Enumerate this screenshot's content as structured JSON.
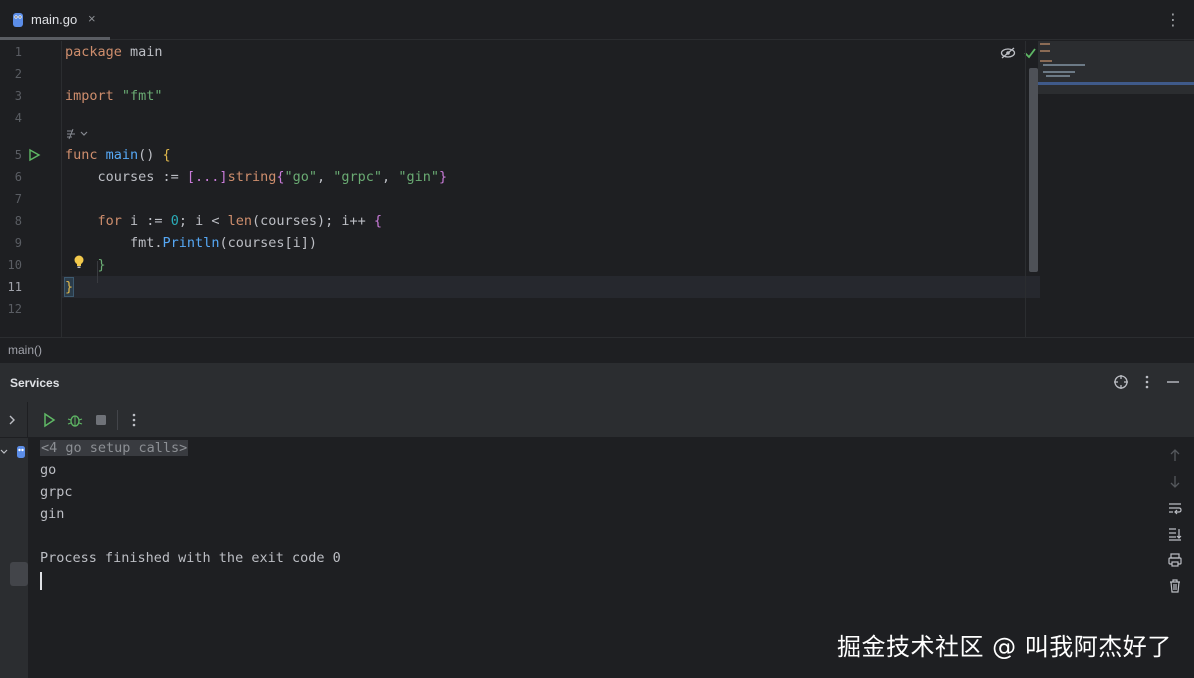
{
  "tabs": [
    {
      "label": "main.go",
      "close": "×"
    }
  ],
  "tab_menu_label": "⋮",
  "editor": {
    "line_numbers": [
      "1",
      "2",
      "3",
      "4",
      "5",
      "6",
      "7",
      "8",
      "9",
      "10",
      "11",
      "12"
    ],
    "current_line": "11",
    "lines": {
      "l1_kw": "package",
      "l1_rest": " main",
      "l3_kw": "import",
      "l3_str": " \"fmt\"",
      "l5_kw": "func",
      "l5_fn": " main",
      "l5_paren": "()",
      "l5_brace": " {",
      "l6_a": "    courses := ",
      "l6_b": "[...]",
      "l6_c": "string",
      "l6_d": "{",
      "l6_e": "\"go\"",
      "l6_f": ", ",
      "l6_g": "\"grpc\"",
      "l6_h": ", ",
      "l6_i": "\"gin\"",
      "l6_j": "}",
      "l8_kw": "    for",
      "l8_a": " i := ",
      "l8_num": "0",
      "l8_b": "; i < ",
      "l8_fn": "len",
      "l8_c": "(courses); i++ ",
      "l8_brace": "{",
      "l9_a": "        fmt.",
      "l9_fn": "Println",
      "l9_b": "(courses[i])",
      "l10": "    }",
      "l11": "}"
    }
  },
  "breadcrumb": "main()",
  "services": {
    "title": "Services",
    "console_lines": {
      "setup": "<4 go setup calls>",
      "out1": "go",
      "out2": "grpc",
      "out3": "gin",
      "finished": "Process finished with the exit code 0"
    }
  },
  "watermark": "掘金技术社区 @ 叫我阿杰好了"
}
